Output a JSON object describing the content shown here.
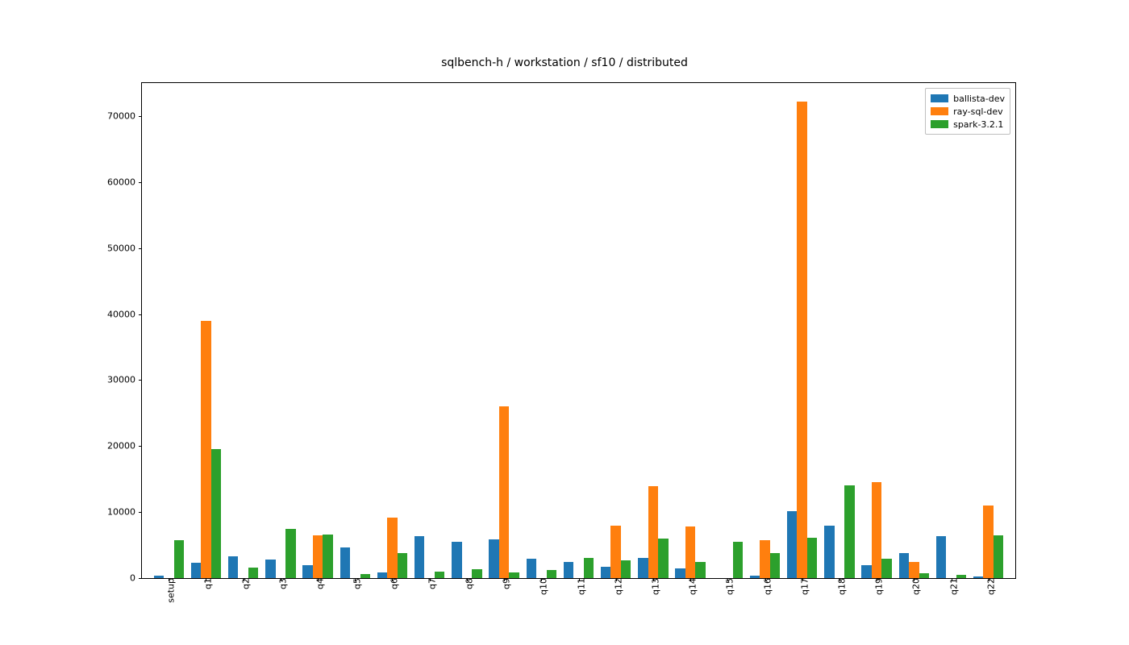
{
  "chart_data": {
    "type": "bar",
    "title": "sqlbench-h / workstation / sf10 / distributed",
    "xlabel": "",
    "ylabel": "",
    "ylim": [
      0,
      75000
    ],
    "yticks": [
      0,
      10000,
      20000,
      30000,
      40000,
      50000,
      60000,
      70000
    ],
    "categories": [
      "setup",
      "q1",
      "q2",
      "q3",
      "q4",
      "q5",
      "q6",
      "q7",
      "q8",
      "q9",
      "q10",
      "q11",
      "q12",
      "q13",
      "q14",
      "q15",
      "q16",
      "q17",
      "q18",
      "q19",
      "q20",
      "q21",
      "q22"
    ],
    "series": [
      {
        "name": "ballista-dev",
        "color": "#1f77b4",
        "values": [
          400,
          2300,
          3300,
          2800,
          2000,
          4600,
          900,
          6300,
          5500,
          5900,
          2900,
          2500,
          1700,
          3000,
          1500,
          0,
          400,
          10100,
          8000,
          1900,
          3800,
          6300,
          200
        ]
      },
      {
        "name": "ray-sql-dev",
        "color": "#ff7f0e",
        "values": [
          0,
          39000,
          0,
          0,
          6500,
          0,
          9200,
          0,
          0,
          26000,
          0,
          0,
          7900,
          13900,
          7800,
          0,
          5700,
          72200,
          0,
          14500,
          2400,
          0,
          11000
        ]
      },
      {
        "name": "spark-3.2.1",
        "color": "#2ca02c",
        "values": [
          5800,
          19500,
          1600,
          7400,
          6600,
          600,
          3800,
          1000,
          1300,
          800,
          1200,
          3000,
          2700,
          6000,
          2500,
          5500,
          3800,
          6100,
          14100,
          2900,
          700,
          500,
          6500
        ]
      }
    ],
    "legend_position": "upper right"
  }
}
